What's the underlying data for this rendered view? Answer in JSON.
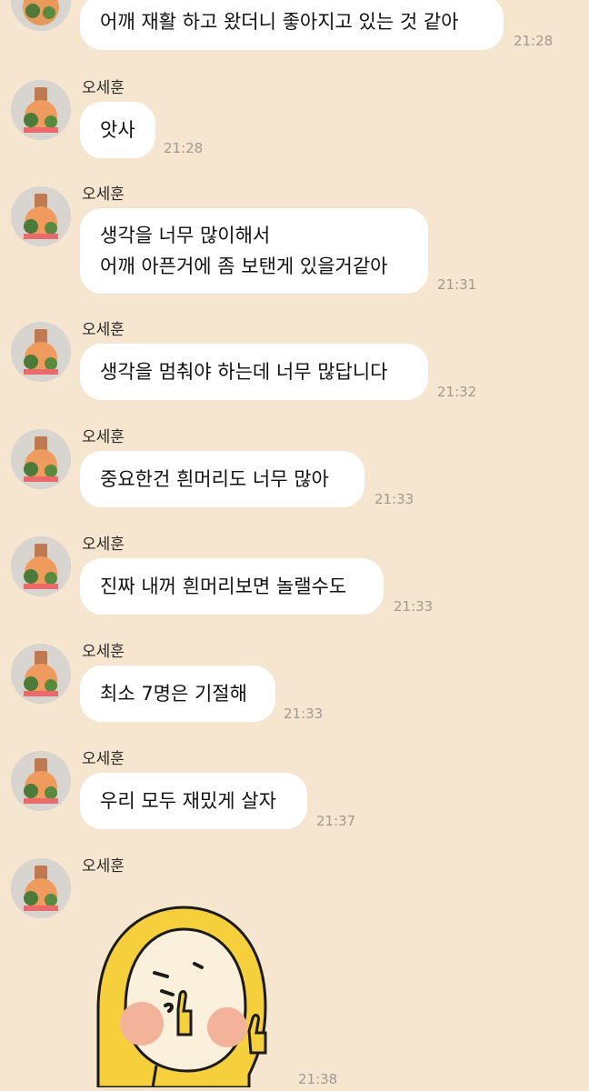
{
  "sender_name": "오세훈",
  "messages": [
    {
      "lines": [
        "어깨 재활 하고 왔더니 좋아지고 있는 것 같아"
      ],
      "time": "21:28"
    },
    {
      "lines": [
        "앗사"
      ],
      "time": "21:28"
    },
    {
      "lines": [
        "생각을 너무 많이해서",
        "어깨 아픈거에 좀 보탠게 있을거같아"
      ],
      "time": "21:31"
    },
    {
      "lines": [
        "생각을 멈춰야 하는데 너무 많답니다"
      ],
      "time": "21:32"
    },
    {
      "lines": [
        "중요한건 흰머리도 너무 많아"
      ],
      "time": "21:33"
    },
    {
      "lines": [
        "진짜 내꺼 흰머리보면 놀랠수도"
      ],
      "time": "21:33"
    },
    {
      "lines": [
        "최소 7명은 기절해"
      ],
      "time": "21:33"
    },
    {
      "lines": [
        "우리 모두 재밌게 살자"
      ],
      "time": "21:37"
    },
    {
      "sticker": "yellow-hood-thumbs-up-sticker",
      "time": "21:38"
    }
  ],
  "colors": {
    "background": "#f6e6cf",
    "bubble": "#ffffff",
    "timestamp": "#a09a91",
    "sticker_yellow": "#f6cf3c",
    "sticker_cheek": "#f2b39a"
  }
}
